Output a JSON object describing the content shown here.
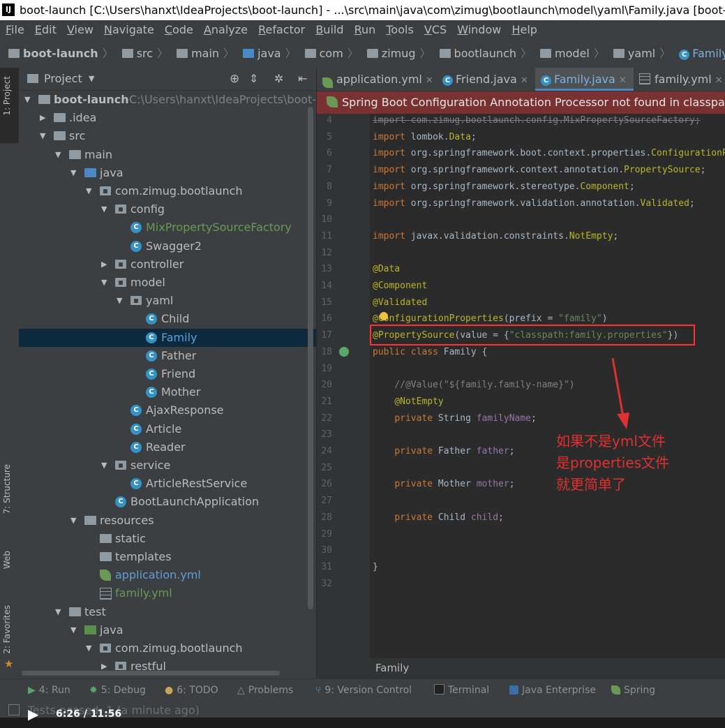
{
  "window": {
    "title": "boot-launch [C:\\Users\\hanxt\\IdeaProjects\\boot-launch] - ...\\src\\main\\java\\com\\zimug\\bootlaunch\\model\\yaml\\Family.java [boot-launch] - In"
  },
  "menu": [
    "File",
    "Edit",
    "View",
    "Navigate",
    "Code",
    "Analyze",
    "Refactor",
    "Build",
    "Run",
    "Tools",
    "VCS",
    "Window",
    "Help"
  ],
  "breadcrumb": [
    "boot-launch",
    "src",
    "main",
    "java",
    "com",
    "zimug",
    "bootlaunch",
    "model",
    "yaml",
    "Family"
  ],
  "side_tabs": {
    "project": "1: Project",
    "structure": "7: Structure",
    "web": "Web",
    "favorites": "2: Favorites"
  },
  "project_panel": {
    "title": "Project"
  },
  "tree": [
    {
      "label": "boot-launch",
      "hint": "C:\\Users\\hanxt\\IdeaProjects\\boot-laun"
    },
    {
      "label": ".idea"
    },
    {
      "label": "src"
    },
    {
      "label": "main"
    },
    {
      "label": "java"
    },
    {
      "label": "com.zimug.bootlaunch"
    },
    {
      "label": "config"
    },
    {
      "label": "MixPropertySourceFactory"
    },
    {
      "label": "Swagger2"
    },
    {
      "label": "controller"
    },
    {
      "label": "model"
    },
    {
      "label": "yaml"
    },
    {
      "label": "Child"
    },
    {
      "label": "Family"
    },
    {
      "label": "Father"
    },
    {
      "label": "Friend"
    },
    {
      "label": "Mother"
    },
    {
      "label": "AjaxResponse"
    },
    {
      "label": "Article"
    },
    {
      "label": "Reader"
    },
    {
      "label": "service"
    },
    {
      "label": "ArticleRestService"
    },
    {
      "label": "BootLaunchApplication"
    },
    {
      "label": "resources"
    },
    {
      "label": "static"
    },
    {
      "label": "templates"
    },
    {
      "label": "application.yml"
    },
    {
      "label": "family.yml"
    },
    {
      "label": "test"
    },
    {
      "label": "java"
    },
    {
      "label": "com.zimug.bootlaunch"
    },
    {
      "label": "restful"
    }
  ],
  "tabs": [
    "application.yml",
    "Friend.java",
    "Family.java",
    "family.yml"
  ],
  "banner": "Spring Boot Configuration Annotation Processor not found in classpath",
  "code": {
    "line_numbers": [
      "4",
      "5",
      "6",
      "7",
      "8",
      "9",
      "10",
      "11",
      "12",
      "13",
      "14",
      "15",
      "16",
      "17",
      "18",
      "19",
      "20",
      "21",
      "22",
      "23",
      "24",
      "25",
      "26",
      "27",
      "28",
      "29",
      "30",
      "31",
      "32"
    ]
  },
  "annotation_note": [
    "如果不是yml文件",
    "是properties文件",
    "就更简单了"
  ],
  "editor_footer": "Family",
  "bottom_tools": [
    "4: Run",
    "5: Debug",
    "6: TODO",
    "Problems",
    "9: Version Control",
    "Terminal",
    "Java Enterprise",
    "Spring"
  ],
  "status": {
    "text": "Tests passed: 1 (a minute ago)",
    "video_time": "6:26 / 11:56"
  }
}
